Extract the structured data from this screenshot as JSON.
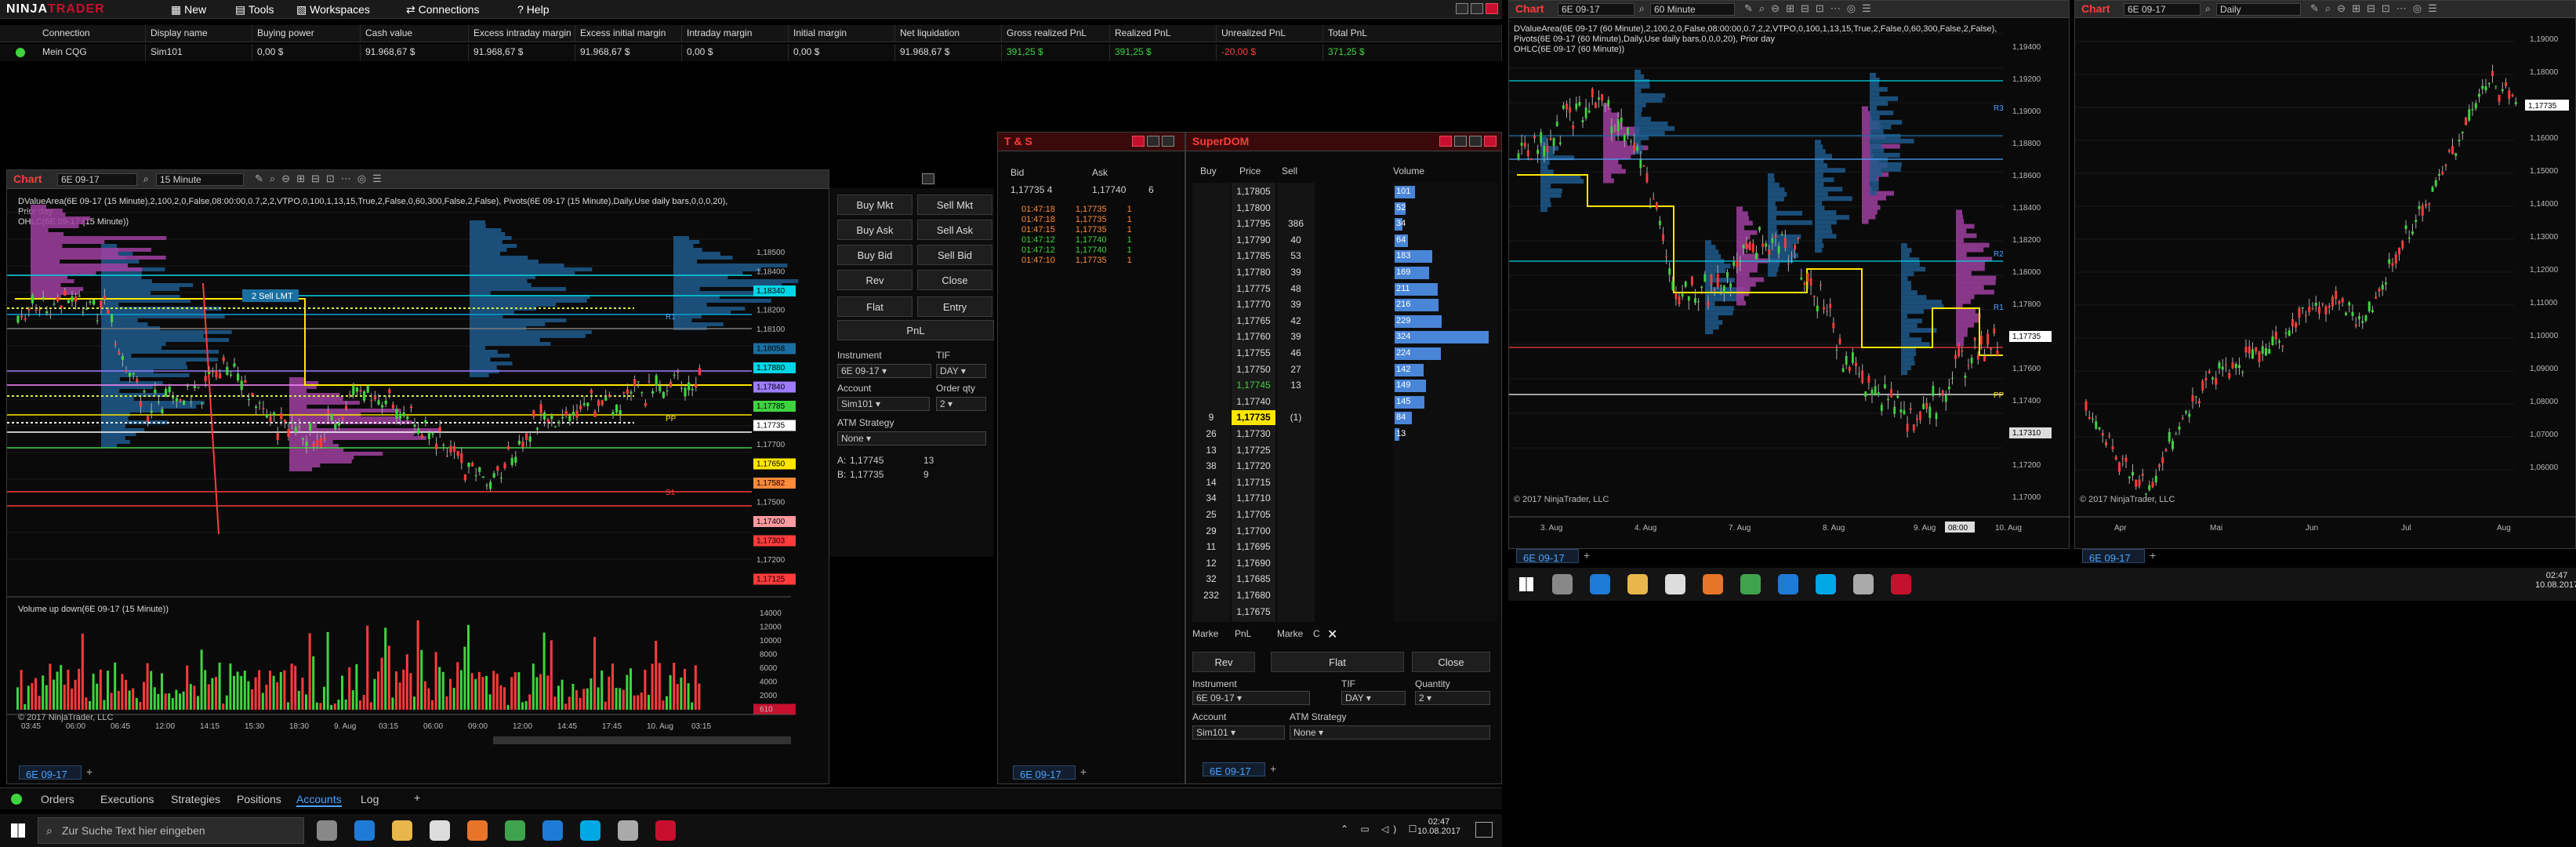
{
  "menu": {
    "logo_a": "NINJA",
    "logo_b": "TRADER",
    "items": [
      "New",
      "Tools",
      "Workspaces",
      "Connections",
      "Help"
    ]
  },
  "accounts": {
    "headers": [
      "Connection",
      "Display name",
      "Buying power",
      "Cash value",
      "Excess intraday margin",
      "Excess initial margin",
      "Intraday margin",
      "Initial margin",
      "Net liquidation",
      "Gross realized PnL",
      "Realized PnL",
      "Unrealized PnL",
      "Total PnL"
    ],
    "row": [
      "Mein CQG",
      "Sim101",
      "0,00 $",
      "91.968,67 $",
      "91.968,67 $",
      "91.968,67 $",
      "0,00 $",
      "0,00 $",
      "91.968,67 $",
      "391,25 $",
      "391,25 $",
      "-20,00 $",
      "371,25 $"
    ]
  },
  "colors": {
    "accent_red": "#c8102e",
    "positive": "#3fd43f",
    "negative": "#ff3b3b",
    "link_blue": "#4aa3ff",
    "cyan_line": "#00d6e6",
    "yellow_line": "#ffe600",
    "volume_blue": "#1f5b8c",
    "volume_magenta": "#a040a0"
  },
  "chart_left": {
    "title": "Chart",
    "instrument": "6E 09-17",
    "interval": "15 Minute",
    "indicator_line1": "DValueArea(6E 09-17 (15 Minute),2,100,2,0,False,08:00:00,0.7,2,2,VTPO,0,100,1,13,15,True,2,False,0,60,300,False,2,False), Pivots(6E 09-17 (15 Minute),Daily,Use daily bars,0,0,0,20), Prior day",
    "indicator_line2": "OHLC(6E 09-17 (15 Minute))",
    "order_label": "2  Sell LMT",
    "price_labels": [
      "1,18500",
      "1,18400",
      "1,18340",
      "1,18200",
      "1,18100",
      "1,18058",
      "1,17880",
      "1,17840",
      "1,17785",
      "1,17735",
      "1,17700",
      "1,17650",
      "1,17582",
      "1,17500",
      "1,17400",
      "1,17303",
      "1,17200",
      "1,17125"
    ],
    "time_labels": [
      "03:45",
      "06:00",
      "06:45",
      "12:00",
      "14:15",
      "15:30",
      "18:30",
      "9. Aug",
      "03:15",
      "06:00",
      "09:00",
      "12:00",
      "14:45",
      "17:45",
      "10. Aug",
      "03:15"
    ],
    "volume_title": "Volume up down(6E 09-17 (15 Minute))",
    "volume_axis": [
      "14000",
      "12000",
      "10000",
      "8000",
      "6000",
      "4000",
      "2000",
      "610"
    ],
    "copyright": "© 2017 NinjaTrader, LLC",
    "pivot_labels": [
      "R1",
      "PP",
      "S1"
    ],
    "tab": "6E 09-17"
  },
  "chart_trader": {
    "buttons": [
      "Buy Mkt",
      "Sell Mkt",
      "Buy Ask",
      "Sell Ask",
      "Buy Bid",
      "Sell Bid",
      "Rev",
      "Close",
      "Flat",
      "Entry",
      "PnL"
    ],
    "instrument_label": "Instrument",
    "instrument_value": "6E 09-17",
    "tif_label": "TIF",
    "tif_value": "DAY",
    "account_label": "Account",
    "account_value": "Sim101",
    "qty_label": "Order qty",
    "qty_value": "2",
    "atm_label": "ATM Strategy",
    "atm_value": "None",
    "a_label": "A:",
    "a_price": "1,17745",
    "a_size": "13",
    "b_label": "B:",
    "b_price": "1,17735",
    "b_size": "9"
  },
  "ts": {
    "title": "T & S",
    "bid_label": "Bid",
    "ask_label": "Ask",
    "bid_price": "1,17735",
    "bid_size": "4",
    "ask_price": "1,17740",
    "ask_size": "6",
    "rows": [
      {
        "time": "01:47:18",
        "price": "1,17735",
        "size": "1",
        "color": "#ff8a3a"
      },
      {
        "time": "01:47:18",
        "price": "1,17735",
        "size": "1",
        "color": "#ff8a3a"
      },
      {
        "time": "01:47:15",
        "price": "1,17735",
        "size": "1",
        "color": "#ff8a3a"
      },
      {
        "time": "01:47:12",
        "price": "1,17740",
        "size": "1",
        "color": "#3fd43f"
      },
      {
        "time": "01:47:12",
        "price": "1,17740",
        "size": "1",
        "color": "#3fd43f"
      },
      {
        "time": "01:47:10",
        "price": "1,17735",
        "size": "1",
        "color": "#ff8a3a"
      }
    ],
    "tab": "6E 09-17"
  },
  "superdom": {
    "title": "SuperDOM",
    "headers": [
      "Buy",
      "Price",
      "Sell",
      "Volume"
    ],
    "rows": [
      {
        "buy": "",
        "price": "1,17805",
        "sell": "",
        "vol": "101",
        "w": 0.22
      },
      {
        "buy": "",
        "price": "1,17800",
        "sell": "",
        "vol": "52",
        "w": 0.12
      },
      {
        "buy": "",
        "price": "1,17795",
        "sell": "386",
        "vol": "34",
        "w": 0.08
      },
      {
        "buy": "",
        "price": "1,17790",
        "sell": "40",
        "vol": "64",
        "w": 0.14
      },
      {
        "buy": "",
        "price": "1,17785",
        "sell": "53",
        "vol": "183",
        "w": 0.4
      },
      {
        "buy": "",
        "price": "1,17780",
        "sell": "39",
        "vol": "169",
        "w": 0.37
      },
      {
        "buy": "",
        "price": "1,17775",
        "sell": "48",
        "vol": "211",
        "w": 0.46
      },
      {
        "buy": "",
        "price": "1,17770",
        "sell": "39",
        "vol": "216",
        "w": 0.47
      },
      {
        "buy": "",
        "price": "1,17765",
        "sell": "42",
        "vol": "229",
        "w": 0.5
      },
      {
        "buy": "",
        "price": "1,17760",
        "sell": "39",
        "vol": "324",
        "w": 1.0
      },
      {
        "buy": "",
        "price": "1,17755",
        "sell": "46",
        "vol": "224",
        "w": 0.49
      },
      {
        "buy": "",
        "price": "1,17750",
        "sell": "27",
        "vol": "142",
        "w": 0.31
      },
      {
        "buy": "",
        "price": "1,17745",
        "sell": "13",
        "vol": "149",
        "w": 0.33
      },
      {
        "buy": "",
        "price": "1,17740",
        "sell": "",
        "vol": "145",
        "w": 0.32
      },
      {
        "buy": "9",
        "price": "1,17735",
        "sell": "(1)",
        "vol": "84",
        "w": 0.18
      },
      {
        "buy": "26",
        "price": "1,17730",
        "sell": "",
        "vol": "13",
        "w": 0.03
      },
      {
        "buy": "13",
        "price": "1,17725",
        "sell": "",
        "vol": "",
        "w": 0
      },
      {
        "buy": "38",
        "price": "1,17720",
        "sell": "",
        "vol": "",
        "w": 0
      },
      {
        "buy": "14",
        "price": "1,17715",
        "sell": "",
        "vol": "",
        "w": 0
      },
      {
        "buy": "34",
        "price": "1,17710",
        "sell": "",
        "vol": "",
        "w": 0
      },
      {
        "buy": "25",
        "price": "1,17705",
        "sell": "",
        "vol": "",
        "w": 0
      },
      {
        "buy": "29",
        "price": "1,17700",
        "sell": "",
        "vol": "",
        "w": 0
      },
      {
        "buy": "11",
        "price": "1,17695",
        "sell": "",
        "vol": "",
        "w": 0
      },
      {
        "buy": "12",
        "price": "1,17690",
        "sell": "",
        "vol": "",
        "w": 0
      },
      {
        "buy": "32",
        "price": "1,17685",
        "sell": "",
        "vol": "",
        "w": 0
      },
      {
        "buy": "232",
        "price": "1,17680",
        "sell": "",
        "vol": "",
        "w": 0
      },
      {
        "buy": "",
        "price": "1,17675",
        "sell": "",
        "vol": "",
        "w": 0
      }
    ],
    "footer": [
      "Marke",
      "PnL",
      "Marke",
      "C"
    ],
    "rev": "Rev",
    "flat": "Flat",
    "close": "Close",
    "instrument_label": "Instrument",
    "instrument_value": "6E 09-17",
    "tif_label": "TIF",
    "tif_value": "DAY",
    "qty_label": "Quantity",
    "qty_value": "2",
    "account_label": "Account",
    "account_value": "Sim101",
    "atm_label": "ATM Strategy",
    "atm_value": "None",
    "tab": "6E 09-17"
  },
  "chart_mid": {
    "title": "Chart",
    "instrument": "6E 09-17",
    "interval": "60 Minute",
    "indicator_line1": "DValueArea(6E 09-17 (60 Minute),2,100,2,0,False,08:00:00,0.7,2,2,VTPO,0,100,1,13,15,True,2,False,0,60,300,False,2,False), Pivots(6E 09-17 (60 Minute),Daily,Use daily bars,0,0,0,20), Prior day",
    "indicator_line2": "OHLC(6E 09-17 (60 Minute))",
    "price_labels": [
      "1,19400",
      "1,19200",
      "1,19000",
      "1,18800",
      "1,18600",
      "1,18400",
      "1,18200",
      "1,18000",
      "1,17800",
      "1,17735",
      "1,17600",
      "1,17400",
      "1,17310",
      "1,17200",
      "1,17000"
    ],
    "time_labels": [
      "3. Aug",
      "4. Aug",
      "7. Aug",
      "8. Aug",
      "9. Aug",
      "08:00",
      "10. Aug"
    ],
    "pivot_labels": [
      "R3",
      "R2",
      "R1",
      "PP"
    ],
    "copyright": "© 2017 NinjaTrader, LLC",
    "tab": "6E 09-17"
  },
  "chart_right": {
    "title": "Chart",
    "instrument": "6E 09-17",
    "interval": "Daily",
    "price_labels": [
      "1,19000",
      "1,18000",
      "1,17000",
      "1,16000",
      "1,15000",
      "1,14000",
      "1,13000",
      "1,12000",
      "1,11000",
      "1,10000",
      "1,09000",
      "1,08000",
      "1,07000",
      "1,06000"
    ],
    "price_tag": "1,17735",
    "time_labels": [
      "Apr",
      "Mai",
      "Jun",
      "Jul",
      "Aug"
    ],
    "copyright": "© 2017 NinjaTrader, LLC",
    "tab": "6E 09-17"
  },
  "bottom_tabs": [
    "Orders",
    "Executions",
    "Strategies",
    "Positions",
    "Accounts",
    "Log"
  ],
  "taskbar_left": {
    "search_placeholder": "Zur Suche Text hier eingeben",
    "time": "02:47",
    "date": "10.08.2017"
  },
  "taskbar_right": {
    "time": "02:47",
    "date": "10.08.2017"
  }
}
